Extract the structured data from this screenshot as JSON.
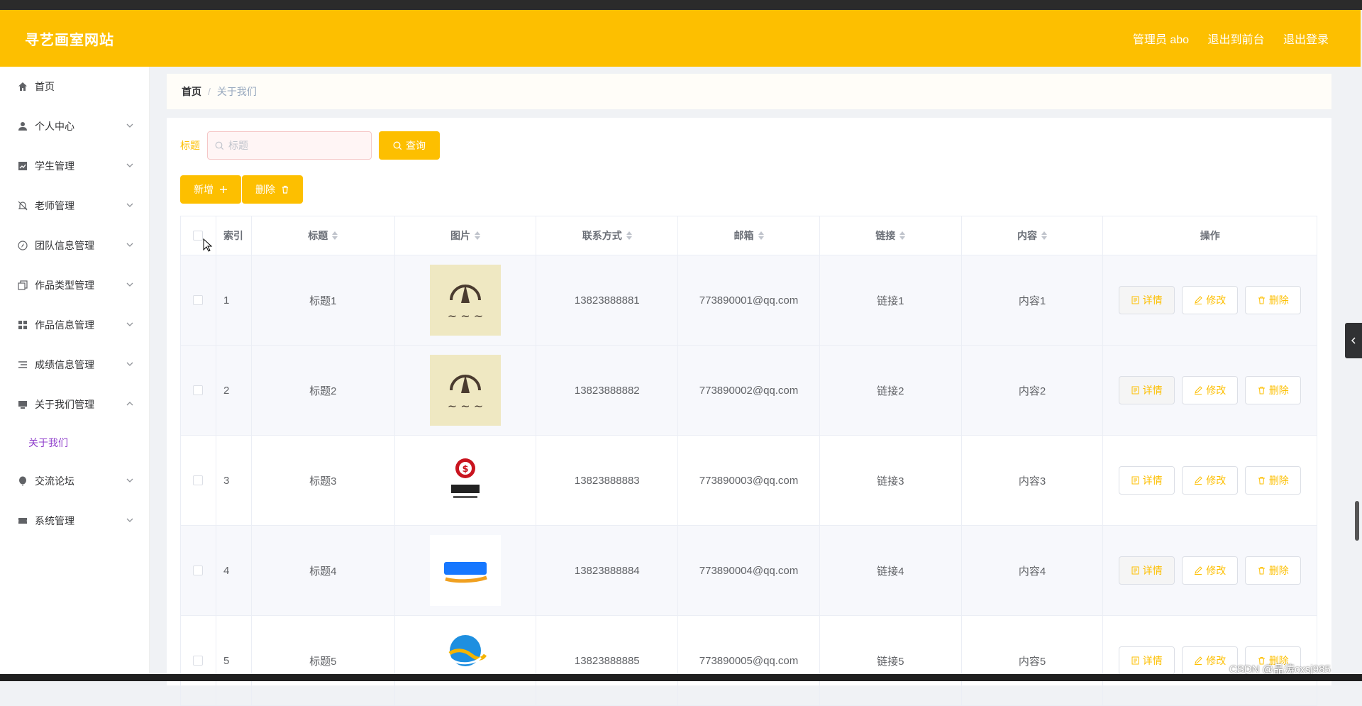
{
  "header": {
    "brand": "寻艺画室网站",
    "admin": "管理员 abo",
    "front": "退出到前台",
    "logout": "退出登录"
  },
  "sidebar": {
    "items": [
      {
        "label": "首页",
        "icon": "home-icon",
        "expandable": false
      },
      {
        "label": "个人中心",
        "icon": "user-icon",
        "expandable": true
      },
      {
        "label": "学生管理",
        "icon": "chart-icon",
        "expandable": true
      },
      {
        "label": "老师管理",
        "icon": "bell-off-icon",
        "expandable": true
      },
      {
        "label": "团队信息管理",
        "icon": "compass-icon",
        "expandable": true
      },
      {
        "label": "作品类型管理",
        "icon": "copy-icon",
        "expandable": true
      },
      {
        "label": "作品信息管理",
        "icon": "grid-icon",
        "expandable": true
      },
      {
        "label": "成绩信息管理",
        "icon": "list-icon",
        "expandable": true
      },
      {
        "label": "关于我们管理",
        "icon": "monitor-icon",
        "expandable": true,
        "expanded": true
      },
      {
        "label": "交流论坛",
        "icon": "balloon-icon",
        "expandable": true
      },
      {
        "label": "系统管理",
        "icon": "ticket-icon",
        "expandable": true
      }
    ],
    "sub_item": "关于我们"
  },
  "breadcrumb": {
    "home": "首页",
    "current": "关于我们"
  },
  "search": {
    "label": "标题",
    "placeholder": "标题",
    "query_button": "查询"
  },
  "actions": {
    "add": "新增",
    "delete": "删除"
  },
  "table": {
    "headers": [
      "索引",
      "标题",
      "图片",
      "联系方式",
      "邮箱",
      "链接",
      "内容",
      "操作"
    ],
    "rows": [
      {
        "index": "1",
        "title": "标题1",
        "image": "logo-kuang-icon",
        "phone": "13823888881",
        "email": "773890001@qq.com",
        "link": "链接1",
        "content": "内容1"
      },
      {
        "index": "2",
        "title": "标题2",
        "image": "logo-kuang-icon",
        "phone": "13823888882",
        "email": "773890002@qq.com",
        "link": "链接2",
        "content": "内容2"
      },
      {
        "index": "3",
        "title": "标题3",
        "image": "logo-shibo-icon",
        "phone": "13823888883",
        "email": "773890003@qq.com",
        "link": "链接3",
        "content": "内容3"
      },
      {
        "index": "4",
        "title": "标题4",
        "image": "logo-alipay-icon",
        "phone": "13823888884",
        "email": "773890004@qq.com",
        "link": "链接4",
        "content": "内容4"
      },
      {
        "index": "5",
        "title": "标题5",
        "image": "logo-wave-icon",
        "phone": "13823888885",
        "email": "773890005@qq.com",
        "link": "链接5",
        "content": "内容5"
      }
    ],
    "ops": {
      "detail": "详情",
      "edit": "修改",
      "delete": "删除"
    }
  },
  "watermark": "CSDN @晶涛cxsj985",
  "colors": {
    "accent": "#fdbf00",
    "submenu": "#8e3ccb"
  }
}
